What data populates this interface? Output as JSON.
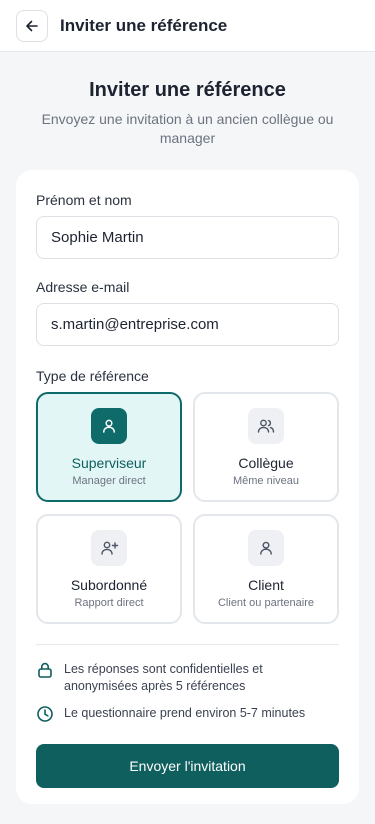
{
  "header": {
    "title": "Inviter une référence",
    "back_icon": "arrow-left-icon"
  },
  "page": {
    "title": "Inviter une référence",
    "subtitle": "Envoyez une invitation à un ancien collègue ou manager"
  },
  "form": {
    "name": {
      "label": "Prénom et nom",
      "value": "Sophie Martin"
    },
    "email": {
      "label": "Adresse e-mail",
      "value": "s.martin@entreprise.com"
    },
    "type": {
      "label": "Type de référence",
      "options": [
        {
          "title": "Superviseur",
          "subtitle": "Manager direct",
          "icon": "user-icon",
          "selected": true
        },
        {
          "title": "Collègue",
          "subtitle": "Même niveau",
          "icon": "users-icon",
          "selected": false
        },
        {
          "title": "Subordonné",
          "subtitle": "Rapport direct",
          "icon": "user-plus-icon",
          "selected": false
        },
        {
          "title": "Client",
          "subtitle": "Client ou partenaire",
          "icon": "user-icon",
          "selected": false
        }
      ]
    }
  },
  "info": [
    {
      "icon": "lock-icon",
      "text": "Les réponses sont confidentielles et anonymisées après 5 références"
    },
    {
      "icon": "clock-icon",
      "text": "Le questionnaire prend environ 5-7 minutes"
    }
  ],
  "submit_label": "Envoyer l'invitation",
  "colors": {
    "accent": "#0f6b6a",
    "accent_light": "#e3f6f6",
    "button": "#0f5f5e"
  }
}
